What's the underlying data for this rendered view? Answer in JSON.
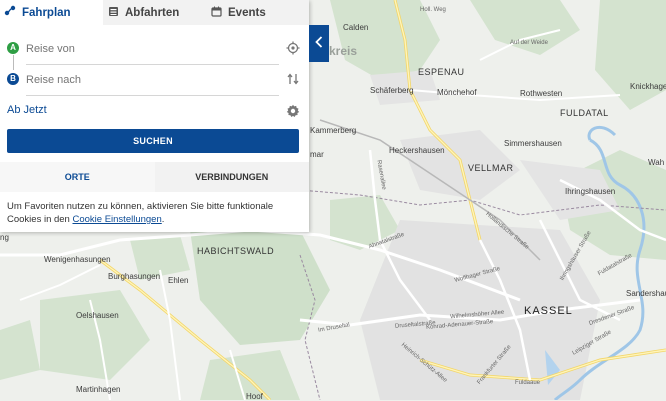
{
  "tabs": [
    {
      "label": "Fahrplan",
      "icon": "route-icon",
      "active": true
    },
    {
      "label": "Abfahrten",
      "icon": "departures-board-icon",
      "active": false
    },
    {
      "label": "Events",
      "icon": "calendar-icon",
      "active": false
    }
  ],
  "journey": {
    "from_marker": "A",
    "to_marker": "B",
    "from_placeholder": "Reise von",
    "to_placeholder": "Reise nach",
    "time_label": "Ab Jetzt",
    "search_label": "SUCHEN"
  },
  "subtabs": [
    {
      "label": "ORTE",
      "active": true
    },
    {
      "label": "VERBINDUNGEN",
      "active": false
    }
  ],
  "cookie_note": {
    "text": "Um Favoriten nutzen zu können, aktivieren Sie bitte funktionale Cookies in den ",
    "link": "Cookie Einstellungen",
    "end": "."
  },
  "map": {
    "places": {
      "calden": "Calden",
      "espenau": "ESPENAU",
      "schaeferberg": "Schäferberg",
      "moenchehof": "Mönchehof",
      "rothwesten": "Rothwesten",
      "fuldatal": "FULDATAL",
      "knickhagen": "Knickhage",
      "kammerberg": "Kammerberg",
      "heckershausen": "Heckershausen",
      "vellmar": "VELLMAR",
      "simmershausen": "Simmershausen",
      "ihringshausen": "Ihringshausen",
      "wah": "Wah",
      "habichtswald": "HABICHTSWALD",
      "wenigenhasungen": "Wenigenhasungen",
      "burghasungen": "Burghasungen",
      "ehlen": "Ehlen",
      "oelshausen": "Oelshausen",
      "kassel": "KASSEL",
      "sandershausen": "Sandershau",
      "martinhagen": "Martinhagen",
      "kreis": "kreis",
      "mar": "mar",
      "ng": "ng",
      "hoof": "Hoof"
    },
    "roads": {
      "holl_weg": "Holl. Weg",
      "auf_der_weide": "Auf der Weide",
      "rasenallee": "Rasenallee",
      "ahnatalstrasse": "Ahnatalstraße",
      "holl_strasse": "Holländische Straße",
      "wolfhager": "Wolfhager Straße",
      "wilhelmshoeher": "Wilhelmshöher Allee",
      "druseltalstrasse": "Druseltalstraße",
      "konrad": "Konrad-Adenauer-Straße",
      "fuldatalstrasse": "Fuldatalstraße",
      "leipziger": "Leipziger Straße",
      "dresdener": "Dresdener Straße",
      "ihringshaeuser": "Ihringshäuser Straße",
      "fulda_aue": "Fuldaaue",
      "im_druseltal": "Im Druseltal",
      "heinrich_schuetz": "Heinrich-Schütz-Allee",
      "frankfurter": "Frankfurter Straße"
    }
  }
}
